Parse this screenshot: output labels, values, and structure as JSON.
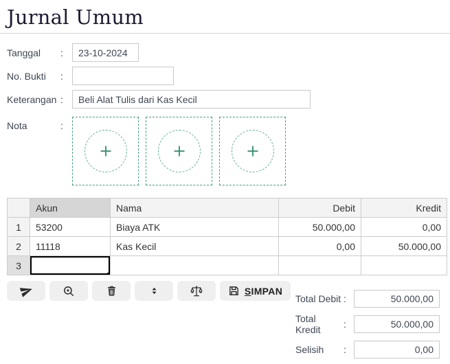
{
  "title": "Jurnal Umum",
  "form": {
    "colon": ":",
    "fields": [
      {
        "label": "Tanggal",
        "value": "23-10-2024"
      },
      {
        "label": "No. Bukti",
        "value": ""
      },
      {
        "label": "Keterangan",
        "value": "Beli Alat Tulis dari Kas Kecil"
      }
    ],
    "nota_label": "Nota",
    "nota_slots": 3
  },
  "table": {
    "headers": {
      "akun": "Akun",
      "nama": "Nama",
      "debit": "Debit",
      "kredit": "Kredit"
    },
    "rows": [
      {
        "num": "1",
        "akun": "53200",
        "nama": "Biaya ATK",
        "debit": "50.000,00",
        "kredit": "0,00"
      },
      {
        "num": "2",
        "akun": "11118",
        "nama": "Kas Kecil",
        "debit": "0,00",
        "kredit": "50.000,00"
      },
      {
        "num": "3",
        "akun": "",
        "nama": "",
        "debit": "",
        "kredit": ""
      }
    ],
    "selection": {
      "row": 3,
      "column": "akun"
    }
  },
  "toolbar": {
    "icons": [
      "paper-plane-icon",
      "zoom-in-icon",
      "trash-icon",
      "sort-vertical-icon",
      "balance-scale-icon",
      "floppy-disk-icon"
    ],
    "save_initial": "S",
    "save_rest": "IMPAN"
  },
  "nota_icon": "plus-icon",
  "totals": [
    {
      "label": "Total Debit",
      "value": "50.000,00"
    },
    {
      "label": "Total Kredit",
      "value": "50.000,00"
    },
    {
      "label": "Selisih",
      "value": "0,00"
    }
  ],
  "colors": {
    "accent_green": "#3fa07c",
    "accent_green_light": "#62b193",
    "selection_border": "#000000",
    "selected_header_bg": "#d6d6d6",
    "header_bg": "#f3f3f3",
    "grid_border": "#cccccc",
    "button_bg": "#efefef",
    "title_color": "#1c1c33"
  }
}
